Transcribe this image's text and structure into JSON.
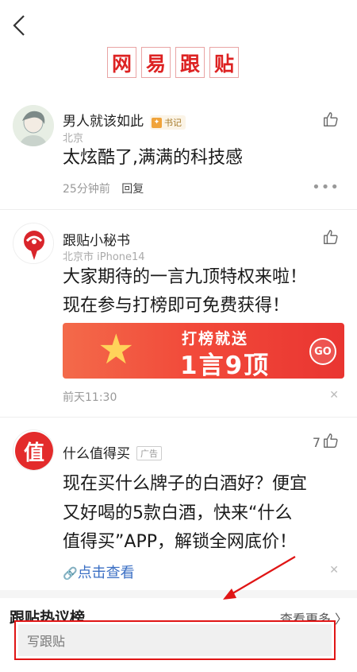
{
  "header": {
    "title_chars": [
      "网",
      "易",
      "跟",
      "贴"
    ]
  },
  "comments": [
    {
      "username": "男人就该如此",
      "badge": "书记",
      "location": "北京",
      "text": "太炫酷了,满满的科技感",
      "time": "25分钟前",
      "reply_label": "回复"
    },
    {
      "username": "跟贴小秘书",
      "location": "北京市 iPhone14",
      "text_line1": "大家期待的一言九顶特权来啦！",
      "text_line2": "现在参与打榜即可免费获得！",
      "banner_line1": "打榜就送",
      "banner_line2": "1言9顶",
      "banner_go": "GO",
      "time": "前天11:30"
    },
    {
      "username": "什么值得买",
      "ad_tag": "广告",
      "avatar_char": "值",
      "like_count": "7",
      "text_line1": "现在买什么牌子的白酒好？便宜",
      "text_line2": "又好喝的5款白酒，快来“什么",
      "text_line3": "值得买”APP，解锁全网底价！",
      "link_label": "点击查看"
    }
  ],
  "section": {
    "title": "跟贴热议榜",
    "more": "查看更多 〉"
  },
  "composer": {
    "placeholder": "写跟贴"
  },
  "colors": {
    "accent_red": "#d22222",
    "highlight_box": "#e01515",
    "link_blue": "#3b6fc4"
  }
}
